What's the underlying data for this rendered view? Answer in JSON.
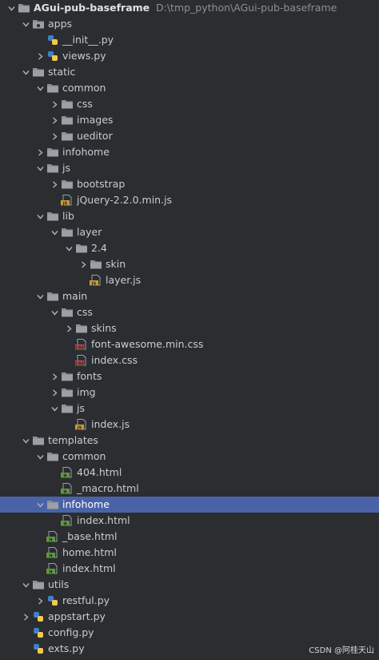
{
  "project": {
    "name": "AGui-pub-baseframe",
    "path": "D:\\tmp_python\\AGui-pub-baseframe"
  },
  "tree": [
    {
      "label": "AGui-pub-baseframe",
      "depth": 0,
      "type": "root",
      "arrow": "down"
    },
    {
      "label": "apps",
      "depth": 1,
      "type": "folder-special",
      "arrow": "down"
    },
    {
      "label": "__init__.py",
      "depth": 2,
      "type": "py",
      "arrow": "none"
    },
    {
      "label": "views.py",
      "depth": 2,
      "type": "py",
      "arrow": "right"
    },
    {
      "label": "static",
      "depth": 1,
      "type": "folder",
      "arrow": "down"
    },
    {
      "label": "common",
      "depth": 2,
      "type": "folder",
      "arrow": "down"
    },
    {
      "label": "css",
      "depth": 3,
      "type": "folder",
      "arrow": "right"
    },
    {
      "label": "images",
      "depth": 3,
      "type": "folder",
      "arrow": "right"
    },
    {
      "label": "ueditor",
      "depth": 3,
      "type": "folder",
      "arrow": "right"
    },
    {
      "label": "infohome",
      "depth": 2,
      "type": "folder",
      "arrow": "right"
    },
    {
      "label": "js",
      "depth": 2,
      "type": "folder",
      "arrow": "down"
    },
    {
      "label": "bootstrap",
      "depth": 3,
      "type": "folder",
      "arrow": "right"
    },
    {
      "label": "jQuery-2.2.0.min.js",
      "depth": 3,
      "type": "jsmin",
      "arrow": "none"
    },
    {
      "label": "lib",
      "depth": 2,
      "type": "folder",
      "arrow": "down"
    },
    {
      "label": "layer",
      "depth": 3,
      "type": "folder",
      "arrow": "down"
    },
    {
      "label": "2.4",
      "depth": 4,
      "type": "folder",
      "arrow": "down"
    },
    {
      "label": "skin",
      "depth": 5,
      "type": "folder",
      "arrow": "right"
    },
    {
      "label": "layer.js",
      "depth": 5,
      "type": "js",
      "arrow": "none"
    },
    {
      "label": "main",
      "depth": 2,
      "type": "folder",
      "arrow": "down"
    },
    {
      "label": "css",
      "depth": 3,
      "type": "folder",
      "arrow": "down"
    },
    {
      "label": "skins",
      "depth": 4,
      "type": "folder",
      "arrow": "right"
    },
    {
      "label": "font-awesome.min.css",
      "depth": 4,
      "type": "css",
      "arrow": "none"
    },
    {
      "label": "index.css",
      "depth": 4,
      "type": "css",
      "arrow": "none"
    },
    {
      "label": "fonts",
      "depth": 3,
      "type": "folder",
      "arrow": "right"
    },
    {
      "label": "img",
      "depth": 3,
      "type": "folder",
      "arrow": "right"
    },
    {
      "label": "js",
      "depth": 3,
      "type": "folder",
      "arrow": "down"
    },
    {
      "label": "index.js",
      "depth": 4,
      "type": "js",
      "arrow": "none"
    },
    {
      "label": "templates",
      "depth": 1,
      "type": "folder",
      "arrow": "down"
    },
    {
      "label": "common",
      "depth": 2,
      "type": "folder",
      "arrow": "down"
    },
    {
      "label": "404.html",
      "depth": 3,
      "type": "html",
      "arrow": "none"
    },
    {
      "label": "_macro.html",
      "depth": 3,
      "type": "html",
      "arrow": "none"
    },
    {
      "label": "infohome",
      "depth": 2,
      "type": "folder",
      "arrow": "down",
      "selected": true
    },
    {
      "label": "index.html",
      "depth": 3,
      "type": "html",
      "arrow": "none"
    },
    {
      "label": "_base.html",
      "depth": 2,
      "type": "html",
      "arrow": "none"
    },
    {
      "label": "home.html",
      "depth": 2,
      "type": "html",
      "arrow": "none"
    },
    {
      "label": "index.html",
      "depth": 2,
      "type": "html",
      "arrow": "none"
    },
    {
      "label": "utils",
      "depth": 1,
      "type": "folder",
      "arrow": "down"
    },
    {
      "label": "restful.py",
      "depth": 2,
      "type": "py",
      "arrow": "right"
    },
    {
      "label": "appstart.py",
      "depth": 1,
      "type": "py",
      "arrow": "right"
    },
    {
      "label": "config.py",
      "depth": 1,
      "type": "py",
      "arrow": "none"
    },
    {
      "label": "exts.py",
      "depth": 1,
      "type": "py",
      "arrow": "none"
    }
  ],
  "watermark": "CSDN @阿桂天山",
  "colors": {
    "background": "#2b2d30",
    "selection": "#4a63a8",
    "folder": "#8b9197",
    "python_blue": "#3f7fc9",
    "python_yellow": "#f2c94c",
    "js_badge": "#c89b3c",
    "css_badge": "#c04b4b",
    "html_badge": "#5f9a3c"
  }
}
